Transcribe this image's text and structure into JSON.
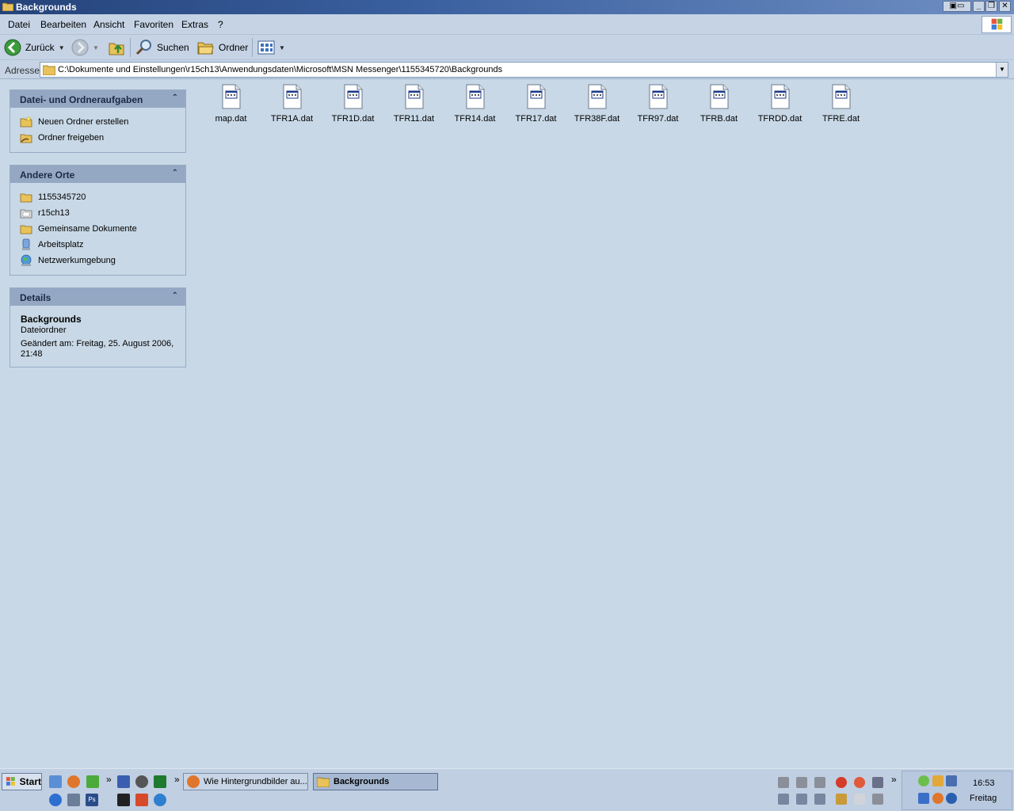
{
  "window": {
    "title": "Backgrounds",
    "controls": [
      "minimize",
      "maximize",
      "close"
    ]
  },
  "menu": {
    "items": [
      "Datei",
      "Bearbeiten",
      "Ansicht",
      "Favoriten",
      "Extras",
      "?"
    ]
  },
  "toolbar": {
    "back_label": "Zurück",
    "search_label": "Suchen",
    "folders_label": "Ordner"
  },
  "address": {
    "label": "Adresse",
    "path": "C:\\Dokumente und Einstellungen\\r15ch13\\Anwendungsdaten\\Microsoft\\MSN Messenger\\1155345720\\Backgrounds"
  },
  "tasks_pane": {
    "title": "Datei- und Ordneraufgaben",
    "links": [
      "Neuen Ordner erstellen",
      "Ordner freigeben"
    ]
  },
  "places_pane": {
    "title": "Andere Orte",
    "links": [
      "1155345720",
      "r15ch13",
      "Gemeinsame Dokumente",
      "Arbeitsplatz",
      "Netzwerkumgebung"
    ]
  },
  "details_pane": {
    "title": "Details",
    "name": "Backgrounds",
    "type": "Dateiordner",
    "modified": "Geändert am: Freitag, 25. August 2006, 21:48"
  },
  "files": [
    "map.dat",
    "TFR1A.dat",
    "TFR1D.dat",
    "TFR11.dat",
    "TFR14.dat",
    "TFR17.dat",
    "TFR38F.dat",
    "TFR97.dat",
    "TFRB.dat",
    "TFRDD.dat",
    "TFRE.dat"
  ],
  "taskbar": {
    "start_label": "Start",
    "tasks": [
      "Wie Hintergrundbilder au...",
      "Backgrounds"
    ],
    "clock_time": "16:53",
    "clock_day": "Freitag",
    "overflow_symbol": "»",
    "tray_expand_symbol": "«"
  }
}
